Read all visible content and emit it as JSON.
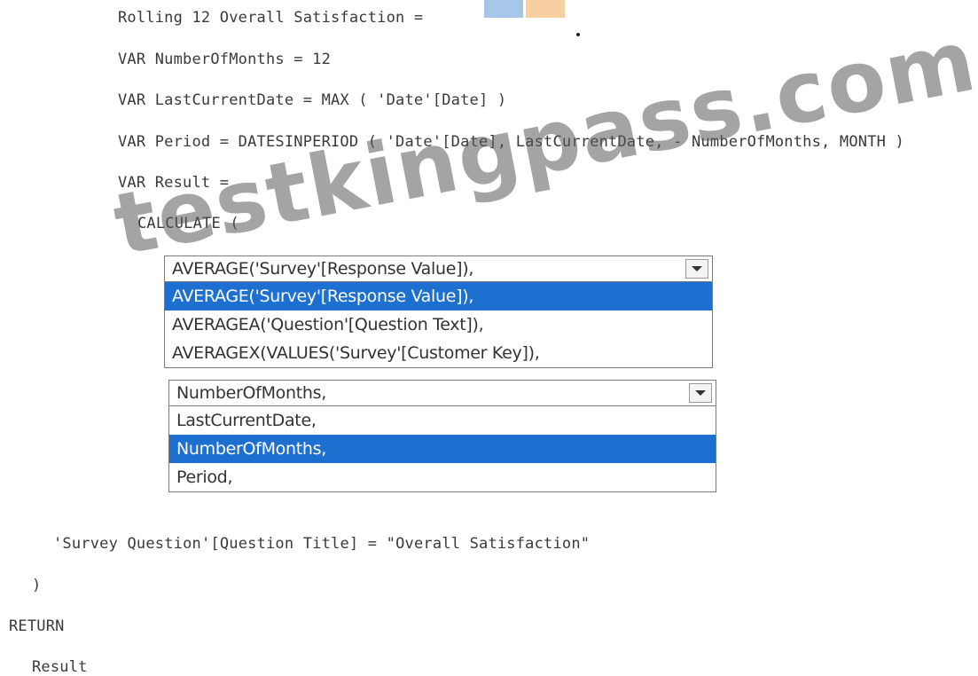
{
  "code": {
    "line1": "Rolling 12 Overall Satisfaction =",
    "line2": "VAR NumberOfMonths = 12",
    "line3": "VAR LastCurrentDate = MAX ( 'Date'[Date] )",
    "line4": "VAR Period = DATESINPERIOD ( 'Date'[Date], LastCurrentDate, - NumberOfMonths, MONTH )",
    "line5": "VAR Result =",
    "line6": "CALCULATE (",
    "line7": "'Survey Question'[Question Title] = \"Overall Satisfaction\"",
    "line8": ")",
    "line9": "RETURN",
    "line10": "Result"
  },
  "dropdown1": {
    "selected_value": "AVERAGE('Survey'[Response Value]),",
    "options": [
      "AVERAGE('Survey'[Response Value]),",
      "AVERAGEA('Question'[Question Text]),",
      "AVERAGEX(VALUES('Survey'[Customer Key]),"
    ],
    "highlighted_index": 0
  },
  "dropdown2": {
    "selected_value": "NumberOfMonths,",
    "options": [
      "LastCurrentDate,",
      "NumberOfMonths,",
      "Period,"
    ],
    "highlighted_index": 1
  },
  "icons": {
    "dropdown_arrow": "chevron-down-icon"
  },
  "colors": {
    "selection": "#1d6fd0",
    "tile_blue": "#a7c7ea",
    "tile_orange": "#f7cfa0"
  },
  "watermark": "testkingpass.com"
}
